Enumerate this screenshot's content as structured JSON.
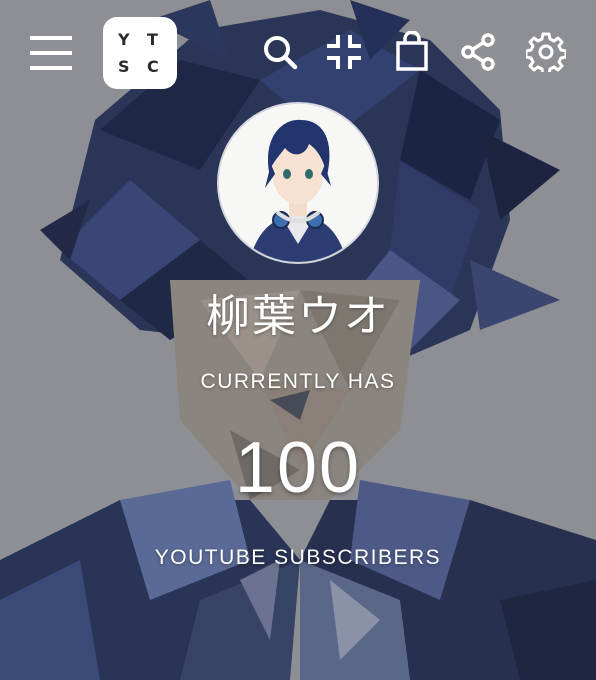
{
  "logo": {
    "letters": [
      "Y",
      "T",
      "S",
      "C"
    ]
  },
  "toolbar": {
    "icons": [
      "menu-icon",
      "search-icon",
      "compress-icon",
      "shopping-bag-icon",
      "share-icon",
      "gear-icon"
    ]
  },
  "channel": {
    "name": "柳葉ウオ",
    "label_top": "CURRENTLY HAS",
    "subscriber_count": "100",
    "label_bottom": "YOUTUBE SUBSCRIBERS"
  },
  "colors": {
    "background": "#8e8f94",
    "accent_dark": "#1f2a4d",
    "text": "#ffffff"
  }
}
